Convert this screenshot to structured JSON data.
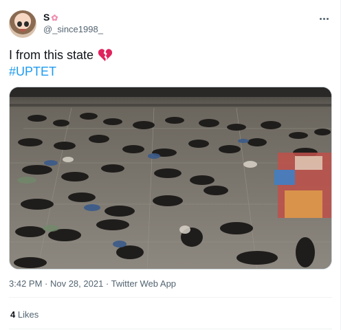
{
  "author": {
    "display_name": "S",
    "name_emoji": "cherry-blossom-icon",
    "handle": "@_since1998_"
  },
  "tweet": {
    "text": "I from this state",
    "emoji": "broken-heart-icon",
    "hashtag": "#UPTET"
  },
  "media": {
    "description_icon": "photo"
  },
  "meta": {
    "timestamp": "3:42 PM · Nov 28, 2021 · Twitter Web App"
  },
  "stats": {
    "likes_count": "4",
    "likes_label": "Likes"
  },
  "colors": {
    "link": "#1d9bf0",
    "secondary_text": "#536471",
    "heart": "#e0245e"
  }
}
